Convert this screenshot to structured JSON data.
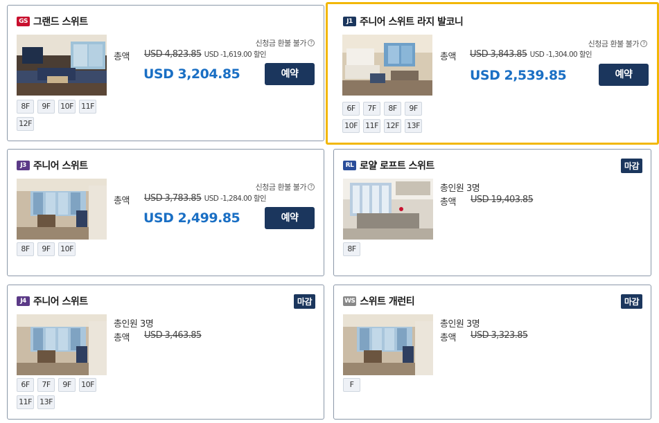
{
  "colors": {
    "brand_navy": "#1b365d",
    "price_blue": "#1a6fc4",
    "selected_border": "#f2b705"
  },
  "common": {
    "total_label": "총액",
    "occupancy_label": "총인원 3명",
    "refund_text": "신청금 환불 불가",
    "refund_icon": "?",
    "book_label": "예약",
    "soldout_label": "마감"
  },
  "cards": [
    {
      "code": "GS",
      "code_color": "#c8102e",
      "name": "그랜드 스위트",
      "original": "USD 4,823.85",
      "discount": "USD -1,619.00 할인",
      "final": "USD 3,204.85",
      "decks": [
        "8F",
        "9F",
        "10F",
        "11F",
        "12F"
      ]
    },
    {
      "code": "J1",
      "code_color": "#1b365d",
      "name": "주니어 스위트 라지 발코니",
      "original": "USD 3,843.85",
      "discount": "USD -1,304.00 할인",
      "final": "USD 2,539.85",
      "decks": [
        "6F",
        "7F",
        "8F",
        "9F",
        "10F",
        "11F",
        "12F",
        "13F"
      ]
    },
    {
      "code": "J3",
      "code_color": "#5b3a87",
      "name": "주니어 스위트",
      "original": "USD 3,783.85",
      "discount": "USD -1,284.00 할인",
      "final": "USD 2,499.85",
      "decks": [
        "8F",
        "9F",
        "10F"
      ]
    },
    {
      "code": "RL",
      "code_color": "#2a4d9a",
      "name": "로얄 로프트 스위트",
      "original": "USD 19,403.85",
      "decks": [
        "8F"
      ]
    },
    {
      "code": "J4",
      "code_color": "#5b3a87",
      "name": "주니어 스위트",
      "original": "USD 3,463.85",
      "decks": [
        "6F",
        "7F",
        "9F",
        "10F",
        "11F",
        "13F"
      ]
    },
    {
      "code": "WS",
      "code_color": "#888888",
      "name": "스위트 개런티",
      "original": "USD 3,323.85",
      "decks": [
        "F"
      ]
    }
  ]
}
